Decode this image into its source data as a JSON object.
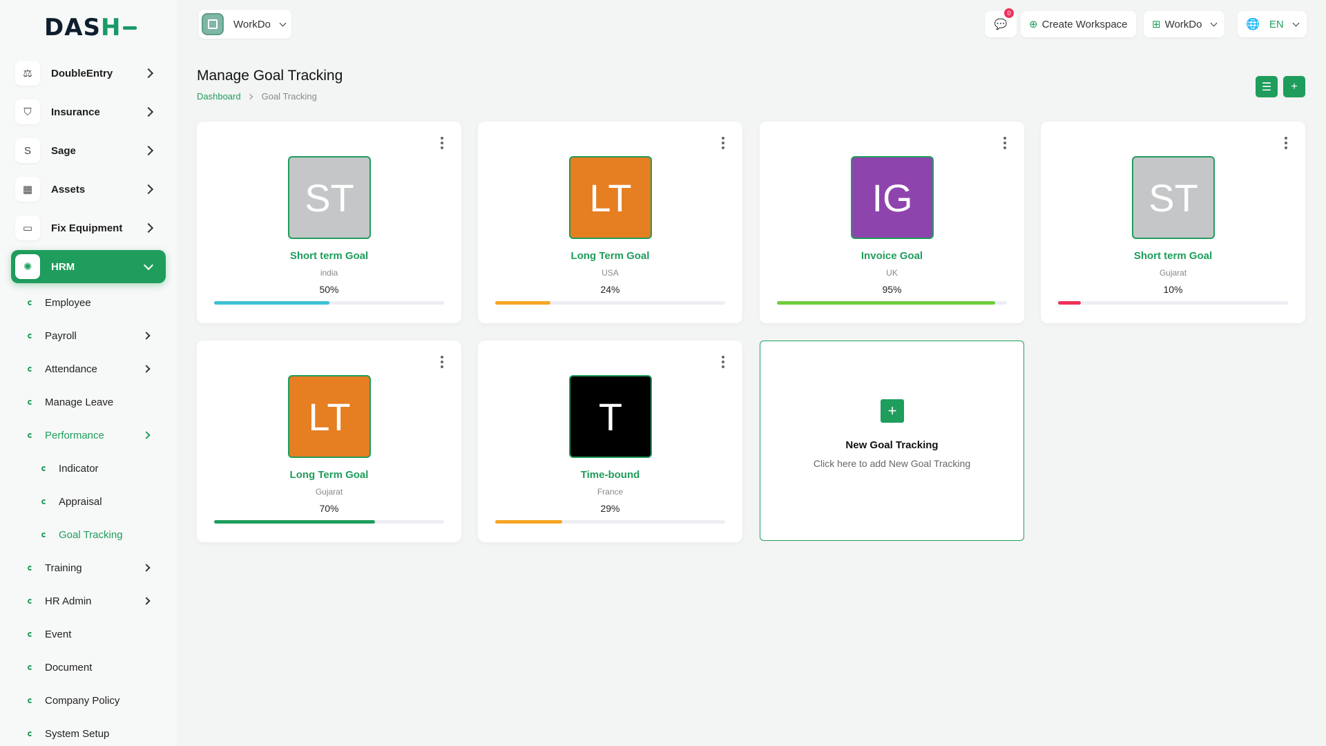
{
  "brand": {
    "logo_text": "DASH",
    "accent": "#1f9d5c"
  },
  "sidebar": {
    "main_items": [
      {
        "label": "DoubleEntry",
        "icon": "scale-icon"
      },
      {
        "label": "Insurance",
        "icon": "shield-icon"
      },
      {
        "label": "Sage",
        "icon": "sage-letter-icon",
        "glyph": "S"
      },
      {
        "label": "Assets",
        "icon": "calculator-icon"
      },
      {
        "label": "Fix Equipment",
        "icon": "archive-icon"
      },
      {
        "label": "HRM",
        "icon": "hrm-icon",
        "active": true
      }
    ],
    "hrm_sub": [
      {
        "label": "Employee"
      },
      {
        "label": "Payroll"
      },
      {
        "label": "Attendance"
      },
      {
        "label": "Manage Leave"
      },
      {
        "label": "Performance"
      },
      {
        "label": "Indicator"
      },
      {
        "label": "Appraisal"
      },
      {
        "label": "Goal Tracking"
      },
      {
        "label": "Training"
      },
      {
        "label": "HR Admin"
      },
      {
        "label": "Event"
      },
      {
        "label": "Document"
      },
      {
        "label": "Company Policy"
      },
      {
        "label": "System Setup"
      }
    ]
  },
  "header": {
    "workspace_label": "WorkDo",
    "notification_count": "0",
    "create_workspace": "Create Workspace",
    "workdo_menu": "WorkDo",
    "language": "EN"
  },
  "page": {
    "title": "Manage Goal Tracking",
    "breadcrumb_home": "Dashboard",
    "breadcrumb_current": "Goal Tracking"
  },
  "goals": [
    {
      "initials": "ST",
      "title": "Short term Goal",
      "location": "india",
      "percent": "50%",
      "progress": 0.5,
      "avatar_color": "#c4c6c8",
      "bar_color": "#3ec0d4"
    },
    {
      "initials": "LT",
      "title": "Long Term Goal",
      "location": "USA",
      "percent": "24%",
      "progress": 0.24,
      "avatar_color": "#e67e22",
      "bar_color": "#f5a524"
    },
    {
      "initials": "IG",
      "title": "Invoice Goal",
      "location": "UK",
      "percent": "95%",
      "progress": 0.95,
      "avatar_color": "#8e44ad",
      "bar_color": "#6fcd3c"
    },
    {
      "initials": "ST",
      "title": "Short term Goal",
      "location": "Gujarat",
      "percent": "10%",
      "progress": 0.1,
      "avatar_color": "#c4c6c8",
      "bar_color": "#f0305a"
    },
    {
      "initials": "LT",
      "title": "Long Term Goal",
      "location": "Gujarat",
      "percent": "70%",
      "progress": 0.7,
      "avatar_color": "#e67e22",
      "bar_color": "#1f9d5c"
    },
    {
      "initials": "T",
      "title": "Time-bound",
      "location": "France",
      "percent": "29%",
      "progress": 0.29,
      "avatar_color": "#000000",
      "bar_color": "#f5a524"
    }
  ],
  "new_goal": {
    "title": "New Goal Tracking",
    "description": "Click here to add New Goal Tracking"
  }
}
